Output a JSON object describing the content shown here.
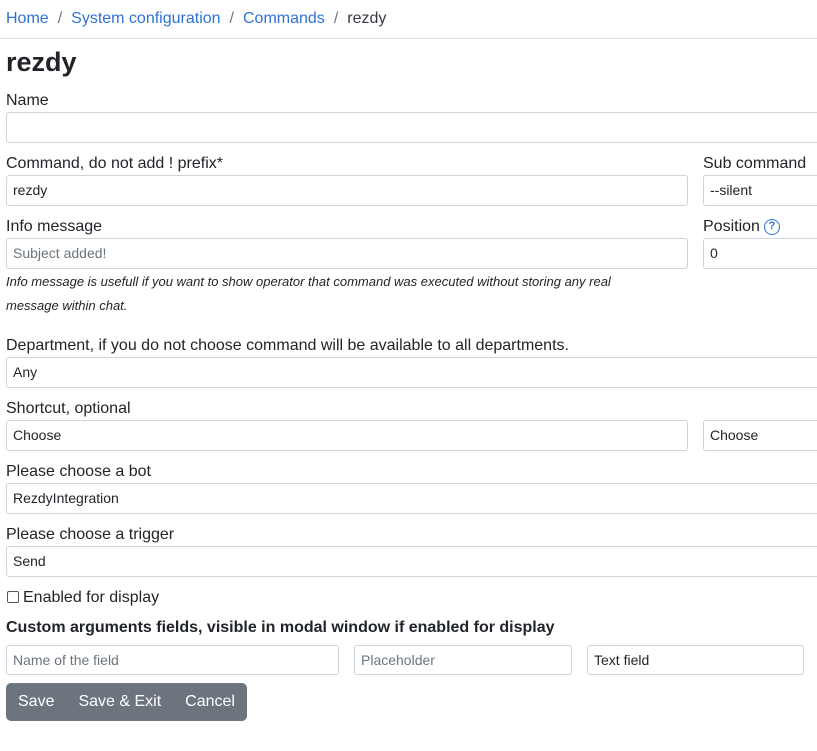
{
  "breadcrumb": {
    "home": "Home",
    "system": "System configuration",
    "commands": "Commands",
    "current": "rezdy",
    "separator": "/"
  },
  "page_title": "rezdy",
  "fields": {
    "name_label": "Name",
    "name_value": "",
    "command_label": "Command, do not add ! prefix*",
    "command_value": "rezdy",
    "sub_command_label": "Sub command",
    "sub_command_value": "--silent",
    "info_label": "Info message",
    "info_value": "Subject added!",
    "position_label": "Position",
    "position_value": "0",
    "info_help_line1": "Info message is usefull if you want to show operator that command was executed without storing any real",
    "info_help_line2": "message within chat.",
    "department_label": "Department, if you do not choose command will be available to all departments.",
    "department_value": "Any",
    "shortcut_label": "Shortcut, optional",
    "shortcut_value1": "Choose",
    "shortcut_value2": "Choose",
    "bot_label": "Please choose a bot",
    "bot_value": "RezdyIntegration",
    "trigger_label": "Please choose a trigger",
    "trigger_value": "Send",
    "enabled_label": "Enabled for display",
    "enabled_checked": false,
    "custom_args_label": "Custom arguments fields, visible in modal window if enabled for display",
    "field_name_placeholder": "Name of the field",
    "field_placeholder_placeholder": "Placeholder",
    "field_type_value": "Text field"
  },
  "icons": {
    "position_help": "question-circle-icon"
  },
  "buttons": {
    "save": "Save",
    "save_exit": "Save & Exit",
    "cancel": "Cancel"
  },
  "colors": {
    "link": "#2f72d6",
    "button_bg": "#6c757d"
  }
}
